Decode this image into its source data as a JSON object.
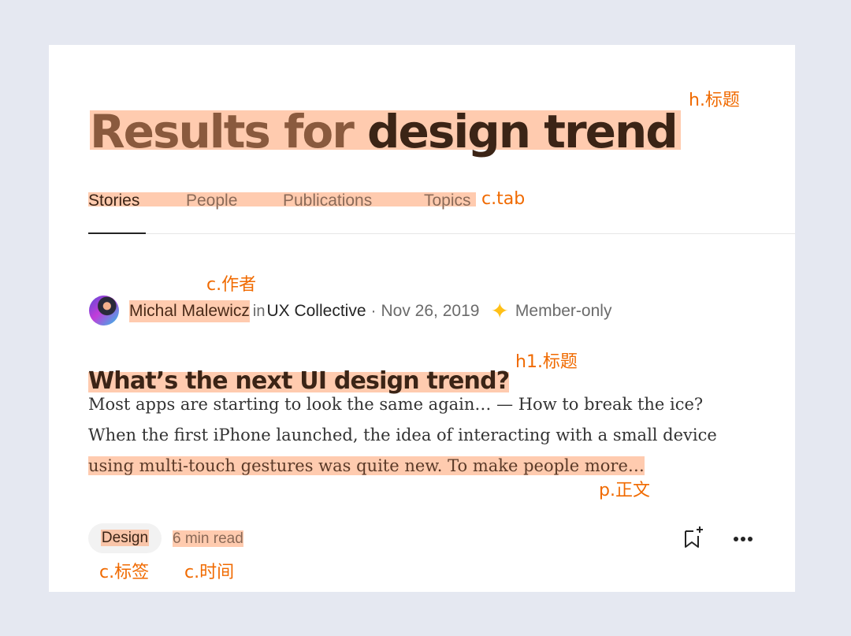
{
  "title": {
    "prefix": "Results for",
    "query": "design trend"
  },
  "tabs": [
    {
      "label": "Stories",
      "active": true
    },
    {
      "label": "People",
      "active": false
    },
    {
      "label": "Publications",
      "active": false
    },
    {
      "label": "Topics",
      "active": false
    }
  ],
  "article": {
    "author": "Michal Malewicz",
    "in_label": "in",
    "publication": "UX Collective",
    "separator": "·",
    "date": "Nov 26, 2019",
    "member_icon": "sparkle-star-icon",
    "member_label": "Member-only",
    "headline": "What’s the next UI design trend?",
    "excerpt_lines": [
      "Most apps are starting to look the same again… — How to break the ice?",
      "When the first iPhone launched, the idea of interacting with a small device",
      "using multi-touch gestures was quite new. To make people more…"
    ],
    "tag": "Design",
    "read_time": "6 min read"
  },
  "annotations": {
    "title_note": "h.标题",
    "tab_note": "c.tab",
    "author_note": "c.作者",
    "h1_note": "h1.标题",
    "body_note": "p.正文",
    "tag_note": "c.标签",
    "time_note": "c.时间"
  },
  "colors": {
    "background": "#e5e8f1",
    "highlight": "#ffb088",
    "annotation": "#f06a00",
    "star": "#ffc017"
  }
}
